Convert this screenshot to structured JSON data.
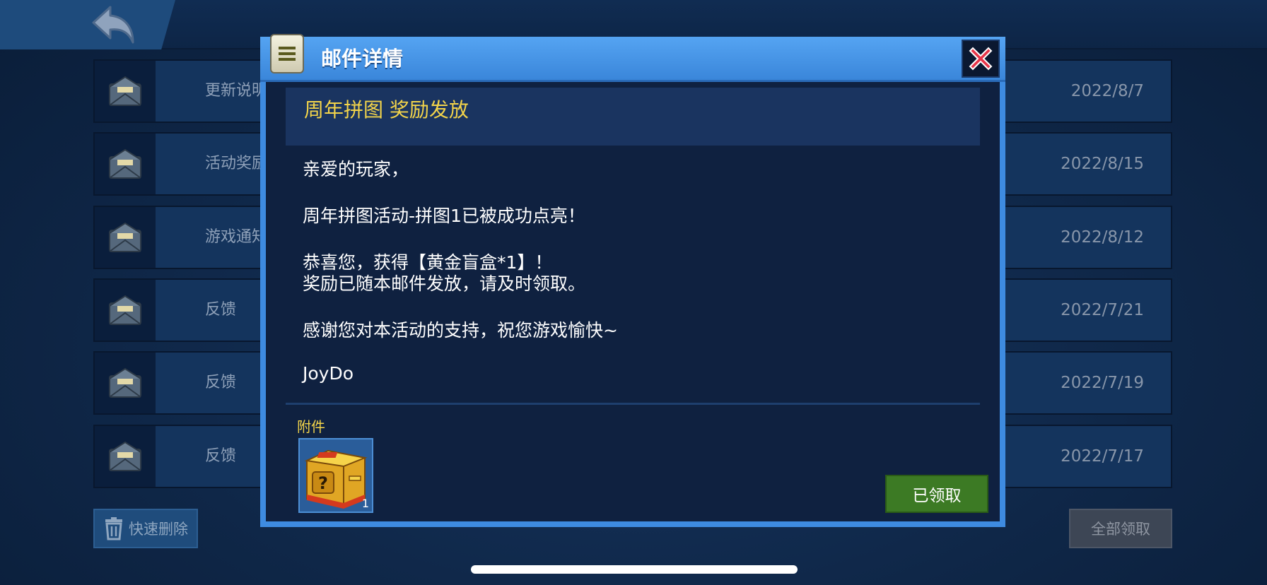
{
  "modal": {
    "title": "邮件详情",
    "subject": "周年拼图 奖励发放",
    "body": [
      "亲爱的玩家，",
      "周年拼图活动-拼图1已被成功点亮！",
      "恭喜您，获得【黄金盲盒*1】！",
      "奖励已随本邮件发放，请及时领取。",
      "感谢您对本活动的支持，祝您游戏愉快~",
      "JoyDo"
    ],
    "attachment_label": "附件",
    "attachment": {
      "item": "黄金盲盒",
      "count": "1"
    },
    "claim_button": "已领取"
  },
  "mail_list": [
    {
      "subject": "更新说明",
      "date": "2022/8/7"
    },
    {
      "subject": "活动奖励",
      "date": "2022/8/15"
    },
    {
      "subject": "游戏通知",
      "date": "2022/8/12"
    },
    {
      "subject": "反馈",
      "date": "2022/7/21"
    },
    {
      "subject": "反馈",
      "date": "2022/7/19"
    },
    {
      "subject": "反馈",
      "date": "2022/7/17"
    }
  ],
  "footer": {
    "quick_delete": "快速删除",
    "collect_all": "全部领取"
  },
  "colors": {
    "accent": "#3e8be0",
    "subject_text": "#f3d44a",
    "claimed": "#3c7a24"
  }
}
